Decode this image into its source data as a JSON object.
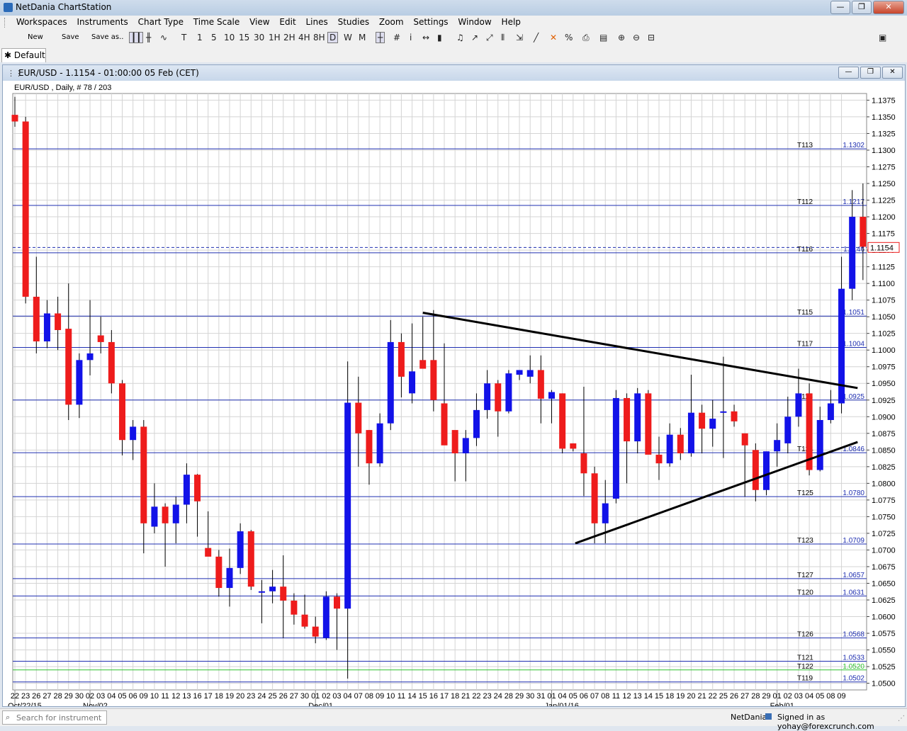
{
  "app": {
    "title": "NetDania ChartStation"
  },
  "window_controls": {
    "minimize": "—",
    "restore": "❐",
    "close": "✕"
  },
  "menu": [
    "Workspaces",
    "Instruments",
    "Chart Type",
    "Time Scale",
    "View",
    "Edit",
    "Lines",
    "Studies",
    "Zoom",
    "Settings",
    "Window",
    "Help"
  ],
  "toolbar": {
    "new_label": "New",
    "save_label": "Save",
    "save_as_label": "Save as..",
    "periods": [
      "T",
      "1",
      "5",
      "10",
      "15",
      "30",
      "1H",
      "2H",
      "4H",
      "8H",
      "D",
      "W",
      "M"
    ],
    "selected_period": "D"
  },
  "tab": {
    "label": "Default"
  },
  "chart_window": {
    "title": "EUR/USD - 1.1154 - 01:00:00  05 Feb (CET)"
  },
  "chart_data": {
    "type": "candlestick",
    "instrument_label": "EUR/USD , Daily, # 78 / 203",
    "last_price": "1.1154",
    "ylim": [
      1.049,
      1.1385
    ],
    "y_ticks": [
      "1.1375",
      "1.1350",
      "1.1325",
      "1.1300",
      "1.1275",
      "1.1250",
      "1.1225",
      "1.1200",
      "1.1175",
      "1.1150",
      "1.1125",
      "1.1100",
      "1.1075",
      "1.1050",
      "1.1025",
      "1.1000",
      "1.0975",
      "1.0950",
      "1.0925",
      "1.0900",
      "1.0875",
      "1.0850",
      "1.0825",
      "1.0800",
      "1.0775",
      "1.0750",
      "1.0725",
      "1.0700",
      "1.0675",
      "1.0650",
      "1.0625",
      "1.0600",
      "1.0575",
      "1.0550",
      "1.0525",
      "1.0500"
    ],
    "x_labels": [
      "22",
      "23",
      "26",
      "27",
      "28",
      "29",
      "30",
      "02",
      "03",
      "04",
      "05",
      "06",
      "09",
      "10",
      "11",
      "12",
      "13",
      "16",
      "17",
      "18",
      "19",
      "20",
      "23",
      "24",
      "25",
      "26",
      "27",
      "30",
      "01",
      "02",
      "03",
      "04",
      "07",
      "08",
      "09",
      "10",
      "11",
      "14",
      "15",
      "16",
      "17",
      "18",
      "21",
      "22",
      "23",
      "24",
      "28",
      "29",
      "30",
      "31",
      "01",
      "04",
      "05",
      "06",
      "07",
      "08",
      "11",
      "12",
      "13",
      "14",
      "15",
      "18",
      "19",
      "20",
      "21",
      "22",
      "25",
      "26",
      "27",
      "28",
      "29",
      "01",
      "02",
      "03",
      "04",
      "05",
      "08",
      "09"
    ],
    "month_labels": [
      {
        "label": "Oct/22/15",
        "index": 0
      },
      {
        "label": "Nov/02",
        "index": 7
      },
      {
        "label": "Dec/01",
        "index": 28
      },
      {
        "label": "Jan/01/16",
        "index": 50
      },
      {
        "label": "Feb/01",
        "index": 71
      }
    ],
    "candles": [
      {
        "o": 1.1353,
        "h": 1.138,
        "l": 1.1335,
        "c": 1.1343
      },
      {
        "o": 1.1343,
        "h": 1.135,
        "l": 1.107,
        "c": 1.108
      },
      {
        "o": 1.108,
        "h": 1.114,
        "l": 1.0995,
        "c": 1.1013
      },
      {
        "o": 1.1013,
        "h": 1.1075,
        "l": 1.1003,
        "c": 1.1055
      },
      {
        "o": 1.1055,
        "h": 1.108,
        "l": 1.1,
        "c": 1.103
      },
      {
        "o": 1.1032,
        "h": 1.11,
        "l": 1.0895,
        "c": 1.0918
      },
      {
        "o": 1.0918,
        "h": 1.0995,
        "l": 1.0898,
        "c": 1.0985
      },
      {
        "o": 1.0985,
        "h": 1.1075,
        "l": 1.0962,
        "c": 1.0995
      },
      {
        "o": 1.1022,
        "h": 1.105,
        "l": 1.0995,
        "c": 1.1012
      },
      {
        "o": 1.1012,
        "h": 1.103,
        "l": 1.0935,
        "c": 1.095
      },
      {
        "o": 1.095,
        "h": 1.0955,
        "l": 1.0842,
        "c": 1.0865
      },
      {
        "o": 1.0865,
        "h": 1.0895,
        "l": 1.0835,
        "c": 1.0885
      },
      {
        "o": 1.0885,
        "h": 1.0895,
        "l": 1.0695,
        "c": 1.074
      },
      {
        "o": 1.0735,
        "h": 1.08,
        "l": 1.0725,
        "c": 1.0765
      },
      {
        "o": 1.0765,
        "h": 1.077,
        "l": 1.0675,
        "c": 1.074
      },
      {
        "o": 1.074,
        "h": 1.078,
        "l": 1.071,
        "c": 1.0768
      },
      {
        "o": 1.0768,
        "h": 1.083,
        "l": 1.074,
        "c": 1.0813
      },
      {
        "o": 1.0813,
        "h": 1.0814,
        "l": 1.072,
        "c": 1.0773
      },
      {
        "o": 1.0703,
        "h": 1.0758,
        "l": 1.0695,
        "c": 1.069
      },
      {
        "o": 1.069,
        "h": 1.07,
        "l": 1.063,
        "c": 1.0643
      },
      {
        "o": 1.0643,
        "h": 1.0702,
        "l": 1.0615,
        "c": 1.0673
      },
      {
        "o": 1.0673,
        "h": 1.074,
        "l": 1.0664,
        "c": 1.0728
      },
      {
        "o": 1.0728,
        "h": 1.073,
        "l": 1.064,
        "c": 1.0645
      },
      {
        "o": 1.0638,
        "h": 1.0655,
        "l": 1.059,
        "c": 1.0638
      },
      {
        "o": 1.0638,
        "h": 1.067,
        "l": 1.062,
        "c": 1.0645
      },
      {
        "o": 1.0645,
        "h": 1.0692,
        "l": 1.0568,
        "c": 1.0624
      },
      {
        "o": 1.0624,
        "h": 1.0635,
        "l": 1.0588,
        "c": 1.0603
      },
      {
        "o": 1.0603,
        "h": 1.0633,
        "l": 1.0582,
        "c": 1.0585
      },
      {
        "o": 1.0585,
        "h": 1.06,
        "l": 1.056,
        "c": 1.057
      },
      {
        "o": 1.0568,
        "h": 1.0638,
        "l": 1.0565,
        "c": 1.063
      },
      {
        "o": 1.063,
        "h": 1.0635,
        "l": 1.055,
        "c": 1.0612
      },
      {
        "o": 1.0612,
        "h": 1.0983,
        "l": 1.0507,
        "c": 1.0921
      },
      {
        "o": 1.0921,
        "h": 1.096,
        "l": 1.0825,
        "c": 1.0875
      },
      {
        "o": 1.088,
        "h": 1.088,
        "l": 1.0798,
        "c": 1.083
      },
      {
        "o": 1.083,
        "h": 1.0905,
        "l": 1.0825,
        "c": 1.089
      },
      {
        "o": 1.089,
        "h": 1.1045,
        "l": 1.088,
        "c": 1.1012
      },
      {
        "o": 1.1012,
        "h": 1.1025,
        "l": 1.0929,
        "c": 1.096
      },
      {
        "o": 1.0935,
        "h": 1.104,
        "l": 1.092,
        "c": 1.0968
      },
      {
        "o": 1.0985,
        "h": 1.105,
        "l": 1.0978,
        "c": 1.0972
      },
      {
        "o": 1.0985,
        "h": 1.106,
        "l": 1.0908,
        "c": 1.0925
      },
      {
        "o": 1.092,
        "h": 1.101,
        "l": 1.088,
        "c": 1.0857
      },
      {
        "o": 1.088,
        "h": 1.087,
        "l": 1.0803,
        "c": 1.0845
      },
      {
        "o": 1.0845,
        "h": 1.088,
        "l": 1.0803,
        "c": 1.0868
      },
      {
        "o": 1.0868,
        "h": 1.0935,
        "l": 1.0856,
        "c": 1.091
      },
      {
        "o": 1.091,
        "h": 1.097,
        "l": 1.0897,
        "c": 1.095
      },
      {
        "o": 1.095,
        "h": 1.0955,
        "l": 1.087,
        "c": 1.0908
      },
      {
        "o": 1.0908,
        "h": 1.097,
        "l": 1.0905,
        "c": 1.0965
      },
      {
        "o": 1.0963,
        "h": 1.097,
        "l": 1.0955,
        "c": 1.097
      },
      {
        "o": 1.096,
        "h": 1.0992,
        "l": 1.095,
        "c": 1.097
      },
      {
        "o": 1.097,
        "h": 1.0992,
        "l": 1.089,
        "c": 1.0927
      },
      {
        "o": 1.0927,
        "h": 1.094,
        "l": 1.089,
        "c": 1.0937
      },
      {
        "o": 1.0935,
        "h": 1.0935,
        "l": 1.0845,
        "c": 1.0852
      },
      {
        "o": 1.086,
        "h": 1.086,
        "l": 1.0848,
        "c": 1.0852
      },
      {
        "o": 1.0845,
        "h": 1.0945,
        "l": 1.0781,
        "c": 1.0815
      },
      {
        "o": 1.0815,
        "h": 1.0825,
        "l": 1.071,
        "c": 1.074
      },
      {
        "o": 1.074,
        "h": 1.0805,
        "l": 1.071,
        "c": 1.077
      },
      {
        "o": 1.0777,
        "h": 1.094,
        "l": 1.077,
        "c": 1.0928
      },
      {
        "o": 1.0928,
        "h": 1.0935,
        "l": 1.08,
        "c": 1.0863
      },
      {
        "o": 1.0863,
        "h": 1.0943,
        "l": 1.0845,
        "c": 1.0935
      },
      {
        "o": 1.0935,
        "h": 1.094,
        "l": 1.0848,
        "c": 1.0843
      },
      {
        "o": 1.0843,
        "h": 1.087,
        "l": 1.0805,
        "c": 1.083
      },
      {
        "o": 1.083,
        "h": 1.089,
        "l": 1.0825,
        "c": 1.0873
      },
      {
        "o": 1.0873,
        "h": 1.0883,
        "l": 1.0835,
        "c": 1.0845
      },
      {
        "o": 1.0845,
        "h": 1.0963,
        "l": 1.084,
        "c": 1.0906
      },
      {
        "o": 1.0906,
        "h": 1.0918,
        "l": 1.0845,
        "c": 1.0882
      },
      {
        "o": 1.0882,
        "h": 1.0925,
        "l": 1.0855,
        "c": 1.0897
      },
      {
        "o": 1.0908,
        "h": 1.099,
        "l": 1.0838,
        "c": 1.0908
      },
      {
        "o": 1.0908,
        "h": 1.0918,
        "l": 1.0885,
        "c": 1.0893
      },
      {
        "o": 1.0875,
        "h": 1.0875,
        "l": 1.078,
        "c": 1.0857
      },
      {
        "o": 1.085,
        "h": 1.086,
        "l": 1.0773,
        "c": 1.079
      },
      {
        "o": 1.079,
        "h": 1.0842,
        "l": 1.0782,
        "c": 1.0848
      },
      {
        "o": 1.0848,
        "h": 1.089,
        "l": 1.0825,
        "c": 1.0865
      },
      {
        "o": 1.086,
        "h": 1.093,
        "l": 1.0845,
        "c": 1.09
      },
      {
        "o": 1.09,
        "h": 1.0972,
        "l": 1.0885,
        "c": 1.0935
      },
      {
        "o": 1.0935,
        "h": 1.095,
        "l": 1.0812,
        "c": 1.082
      },
      {
        "o": 1.082,
        "h": 1.0915,
        "l": 1.0818,
        "c": 1.0895
      },
      {
        "o": 1.0895,
        "h": 1.094,
        "l": 1.089,
        "c": 1.092
      },
      {
        "o": 1.092,
        "h": 1.114,
        "l": 1.0905,
        "c": 1.1092
      },
      {
        "o": 1.1092,
        "h": 1.124,
        "l": 1.1075,
        "c": 1.12
      },
      {
        "o": 1.12,
        "h": 1.125,
        "l": 1.1105,
        "c": 1.1155
      }
    ],
    "horizontal_lines": [
      {
        "label": "T113",
        "value": "1.1302",
        "color": "#1f2fb0"
      },
      {
        "label": "T112",
        "value": "1.1217",
        "color": "#1f2fb0"
      },
      {
        "label": "T116",
        "value": "1.1146",
        "color": "#1f2fb0"
      },
      {
        "label": "T115",
        "value": "1.1051",
        "color": "#1f2fb0"
      },
      {
        "label": "T117",
        "value": "1.1004",
        "color": "#1f2fb0"
      },
      {
        "label": "T118",
        "value": "1.0925",
        "color": "#1f2fb0"
      },
      {
        "label": "T124",
        "value": "1.0846",
        "color": "#1f2fb0"
      },
      {
        "label": "T125",
        "value": "1.0780",
        "color": "#1f2fb0"
      },
      {
        "label": "T123",
        "value": "1.0709",
        "color": "#1f2fb0"
      },
      {
        "label": "T127",
        "value": "1.0657",
        "color": "#1f2fb0"
      },
      {
        "label": "T120",
        "value": "1.0631",
        "color": "#1f2fb0"
      },
      {
        "label": "T126",
        "value": "1.0568",
        "color": "#1f2fb0"
      },
      {
        "label": "T121",
        "value": "1.0533",
        "color": "#1f2fb0"
      },
      {
        "label": "T122",
        "value": "1.0520",
        "color": "#2fc12f"
      },
      {
        "label": "T119",
        "value": "1.0502",
        "color": "#1f2fb0"
      }
    ],
    "trendlines": [
      {
        "x1": 38,
        "y1": 1.1056,
        "x2": 78.5,
        "y2": 1.0943
      },
      {
        "x1": 52.2,
        "y1": 1.071,
        "x2": 78.5,
        "y2": 1.0862
      }
    ],
    "current_price_line": "1.1154",
    "colors": {
      "bull": "#1212e8",
      "bear": "#ee1c1c",
      "grid": "#d4d4d4",
      "level": "#1f2fb0",
      "trend": "#000000"
    }
  },
  "status": {
    "search_placeholder": "Search for instrument",
    "provider": "NetDania",
    "signed_in": "Signed in as yohay@forexcrunch.com"
  }
}
